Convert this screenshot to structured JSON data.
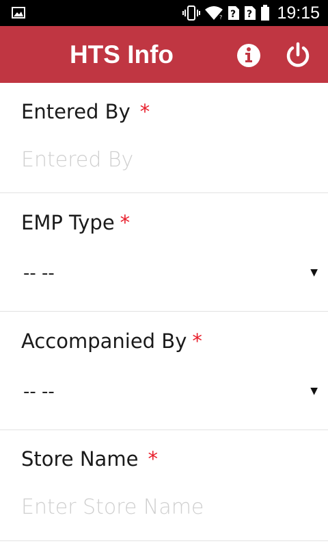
{
  "status_bar": {
    "time": "19:15",
    "icons": [
      "gallery-icon",
      "vibrate-icon",
      "wifi-icon",
      "no-sim-icon",
      "no-sim-icon",
      "battery-icon"
    ]
  },
  "header": {
    "title": "HTS Info",
    "color": "#c03642",
    "actions": [
      "info-icon",
      "power-icon"
    ]
  },
  "form": {
    "entered_by": {
      "label": "Entered By",
      "required": "*",
      "placeholder": "Entered By"
    },
    "emp_type": {
      "label": "EMP Type",
      "required": "*",
      "selected": "-- --"
    },
    "accompanied_by": {
      "label": "Accompanied By",
      "required": "*",
      "selected": "-- --"
    },
    "store_name": {
      "label": "Store Name",
      "required": "*",
      "placeholder": "Enter Store Name"
    }
  }
}
